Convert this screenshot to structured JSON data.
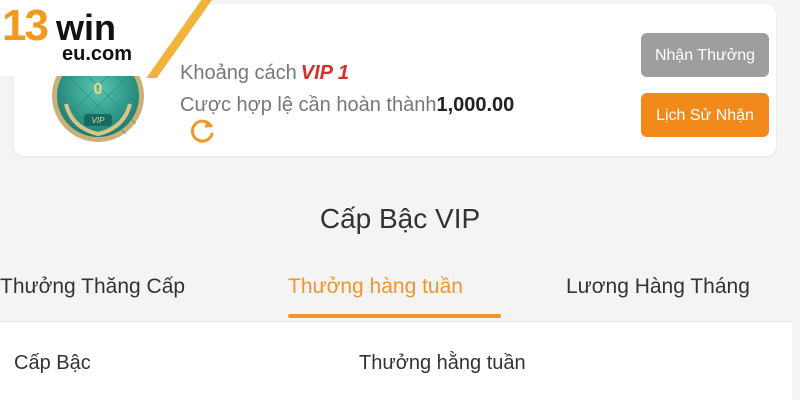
{
  "brand": {
    "logo_number": "13",
    "logo_word": "win",
    "logo_domain": "eu.com",
    "accent_color": "#f0962c"
  },
  "vip_card": {
    "level_number": "0",
    "distance_label": "Khoảng cách",
    "target_level": "VIP 1",
    "bet_label": "Cược hợp lệ cần hoàn thành",
    "bet_amount": "1,000.00",
    "refresh_icon": "refresh-icon",
    "claim_button": "Nhận Thưởng",
    "claim_button_state": "disabled",
    "history_button": "Lịch Sử Nhận"
  },
  "section": {
    "title": "Cấp Bậc VIP"
  },
  "tabs": [
    {
      "label": "Thưởng Thăng Cấp",
      "active": false
    },
    {
      "label": "Thưởng hàng tuần",
      "active": true
    },
    {
      "label": "Lương Hàng Tháng",
      "active": false
    }
  ],
  "table": {
    "columns": [
      "Cấp Bậc",
      "Thưởng hằng tuần"
    ]
  }
}
